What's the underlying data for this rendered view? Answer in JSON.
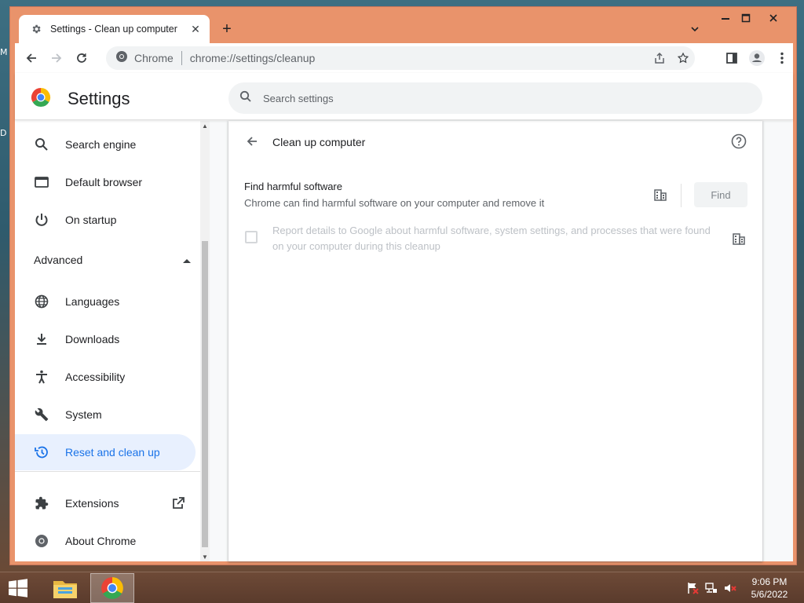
{
  "desktop": {
    "label_m": "M",
    "label_d": "D"
  },
  "browser": {
    "tab": {
      "title": "Settings - Clean up computer",
      "close": "✕"
    },
    "newtab": "+",
    "window_controls": {
      "minimize": "—",
      "maximize": "☐",
      "close": "✕"
    },
    "omnibox": {
      "site_name": "Chrome",
      "url": "chrome://settings/cleanup"
    }
  },
  "settings": {
    "title": "Settings",
    "search_placeholder": "Search settings",
    "sidebar": {
      "items_top": [
        {
          "label": "Search engine",
          "icon": "search-icon"
        },
        {
          "label": "Default browser",
          "icon": "browser-icon"
        },
        {
          "label": "On startup",
          "icon": "power-icon"
        }
      ],
      "advanced_label": "Advanced",
      "items_advanced": [
        {
          "label": "Languages",
          "icon": "globe-icon"
        },
        {
          "label": "Downloads",
          "icon": "download-icon"
        },
        {
          "label": "Accessibility",
          "icon": "accessibility-icon"
        },
        {
          "label": "System",
          "icon": "wrench-icon"
        },
        {
          "label": "Reset and clean up",
          "icon": "history-icon",
          "active": true
        }
      ],
      "items_bottom": [
        {
          "label": "Extensions",
          "icon": "puzzle-icon"
        },
        {
          "label": "About Chrome",
          "icon": "chrome-icon"
        }
      ]
    },
    "cleanup": {
      "title": "Clean up computer",
      "find_title": "Find harmful software",
      "find_subtitle": "Chrome can find harmful software on your computer and remove it",
      "find_button": "Find",
      "report_text": "Report details to Google about harmful software, system settings, and processes that were found on your computer during this cleanup",
      "report_checked": false
    }
  },
  "taskbar": {
    "time": "9:06 PM",
    "date": "5/6/2022"
  },
  "colors": {
    "accent": "#1a73e8",
    "window_frame": "#e9936b",
    "active_nav_bg": "#e8f0fe"
  }
}
